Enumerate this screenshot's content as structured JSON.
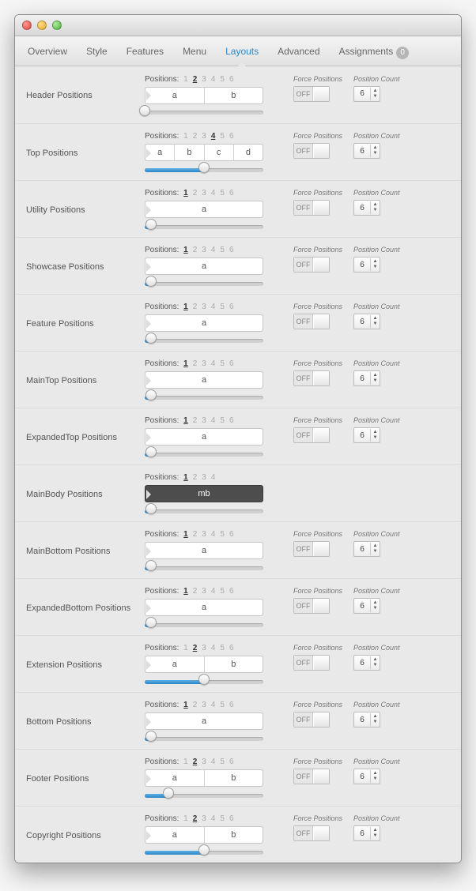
{
  "tabs": {
    "items": [
      "Overview",
      "Style",
      "Features",
      "Menu",
      "Layouts",
      "Advanced",
      "Assignments"
    ],
    "active": 4,
    "badge": "0"
  },
  "labels": {
    "positions_prefix": "Positions:",
    "force_positions": "Force Positions",
    "position_count": "Position Count",
    "toggle_off": "OFF"
  },
  "rows": [
    {
      "title": "Header Positions",
      "max": 6,
      "active": 2,
      "cells": [
        "a",
        "b"
      ],
      "slider": 0,
      "force": true,
      "count": 6
    },
    {
      "title": "Top Positions",
      "max": 6,
      "active": 4,
      "cells": [
        "a",
        "b",
        "c",
        "d"
      ],
      "slider": 50,
      "force": true,
      "count": 6
    },
    {
      "title": "Utility Positions",
      "max": 6,
      "active": 1,
      "cells": [
        "a"
      ],
      "slider": 5,
      "force": true,
      "count": 6
    },
    {
      "title": "Showcase Positions",
      "max": 6,
      "active": 1,
      "cells": [
        "a"
      ],
      "slider": 5,
      "force": true,
      "count": 6
    },
    {
      "title": "Feature Positions",
      "max": 6,
      "active": 1,
      "cells": [
        "a"
      ],
      "slider": 5,
      "force": true,
      "count": 6
    },
    {
      "title": "MainTop Positions",
      "max": 6,
      "active": 1,
      "cells": [
        "a"
      ],
      "slider": 5,
      "force": true,
      "count": 6
    },
    {
      "title": "ExpandedTop Positions",
      "max": 6,
      "active": 1,
      "cells": [
        "a"
      ],
      "slider": 5,
      "force": true,
      "count": 6
    },
    {
      "title": "MainBody Positions",
      "max": 4,
      "active": 1,
      "cells": [
        "mb"
      ],
      "slider": 5,
      "force": false,
      "dark": true
    },
    {
      "title": "MainBottom Positions",
      "max": 6,
      "active": 1,
      "cells": [
        "a"
      ],
      "slider": 5,
      "force": true,
      "count": 6
    },
    {
      "title": "ExpandedBottom Positions",
      "max": 6,
      "active": 1,
      "cells": [
        "a"
      ],
      "slider": 5,
      "force": true,
      "count": 6
    },
    {
      "title": "Extension Positions",
      "max": 6,
      "active": 2,
      "cells": [
        "a",
        "b"
      ],
      "slider": 50,
      "force": true,
      "count": 6
    },
    {
      "title": "Bottom Positions",
      "max": 6,
      "active": 1,
      "cells": [
        "a"
      ],
      "slider": 5,
      "force": true,
      "count": 6
    },
    {
      "title": "Footer Positions",
      "max": 6,
      "active": 2,
      "cells": [
        "a",
        "b"
      ],
      "slider": 20,
      "force": true,
      "count": 6
    },
    {
      "title": "Copyright Positions",
      "max": 6,
      "active": 2,
      "cells": [
        "a",
        "b"
      ],
      "slider": 50,
      "force": true,
      "count": 6
    }
  ]
}
